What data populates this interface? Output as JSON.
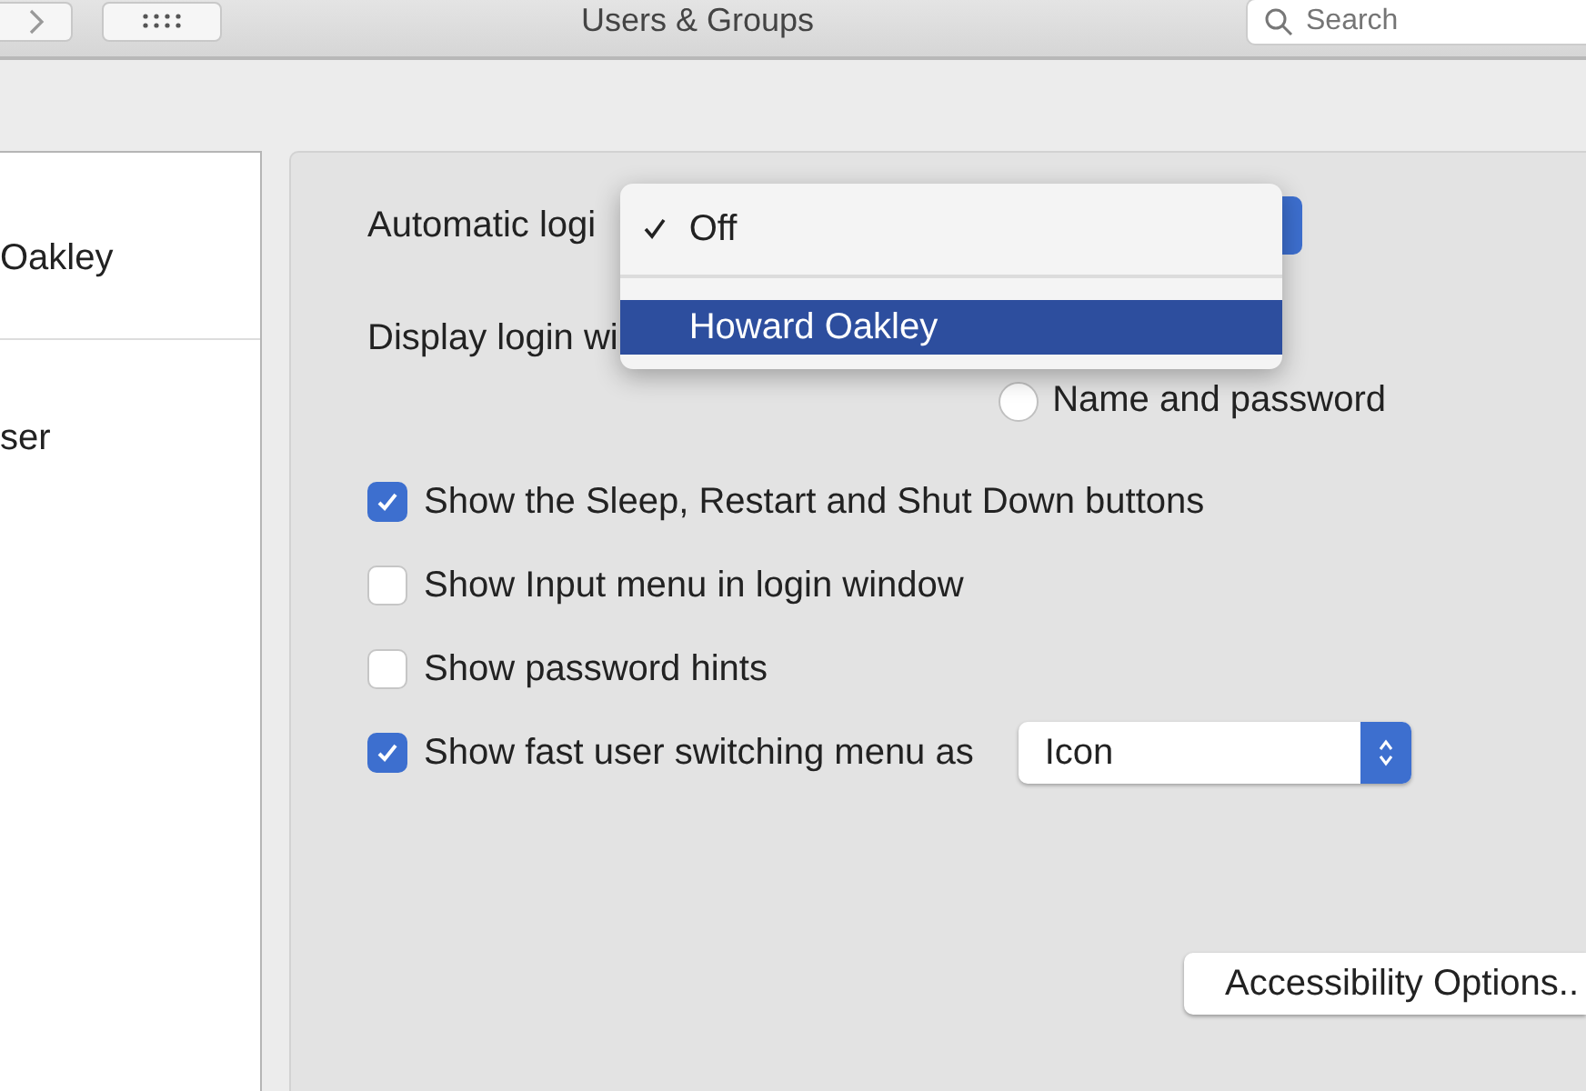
{
  "toolbar": {
    "title": "Users & Groups",
    "search": {
      "placeholder": "Search"
    }
  },
  "sidebar": {
    "items": [
      {
        "label": "Oakley"
      },
      {
        "label": "ser"
      }
    ]
  },
  "automatic_login": {
    "label": "Automatic logi",
    "menu": [
      {
        "label": "Off",
        "checked": true,
        "selected": false
      },
      {
        "label": "Howard Oakley",
        "checked": false,
        "selected": true
      }
    ]
  },
  "display_login_window": {
    "label": "Display login wi",
    "options": [
      {
        "label": "Name and password",
        "selected": false
      }
    ]
  },
  "checkboxes": [
    {
      "label": "Show the Sleep, Restart and Shut Down buttons",
      "checked": true
    },
    {
      "label": "Show Input menu in login window",
      "checked": false
    },
    {
      "label": "Show password hints",
      "checked": false
    },
    {
      "label": "Show fast user switching menu as",
      "checked": true,
      "popup": "Icon"
    }
  ],
  "accessibility_button": "Accessibility Options.."
}
